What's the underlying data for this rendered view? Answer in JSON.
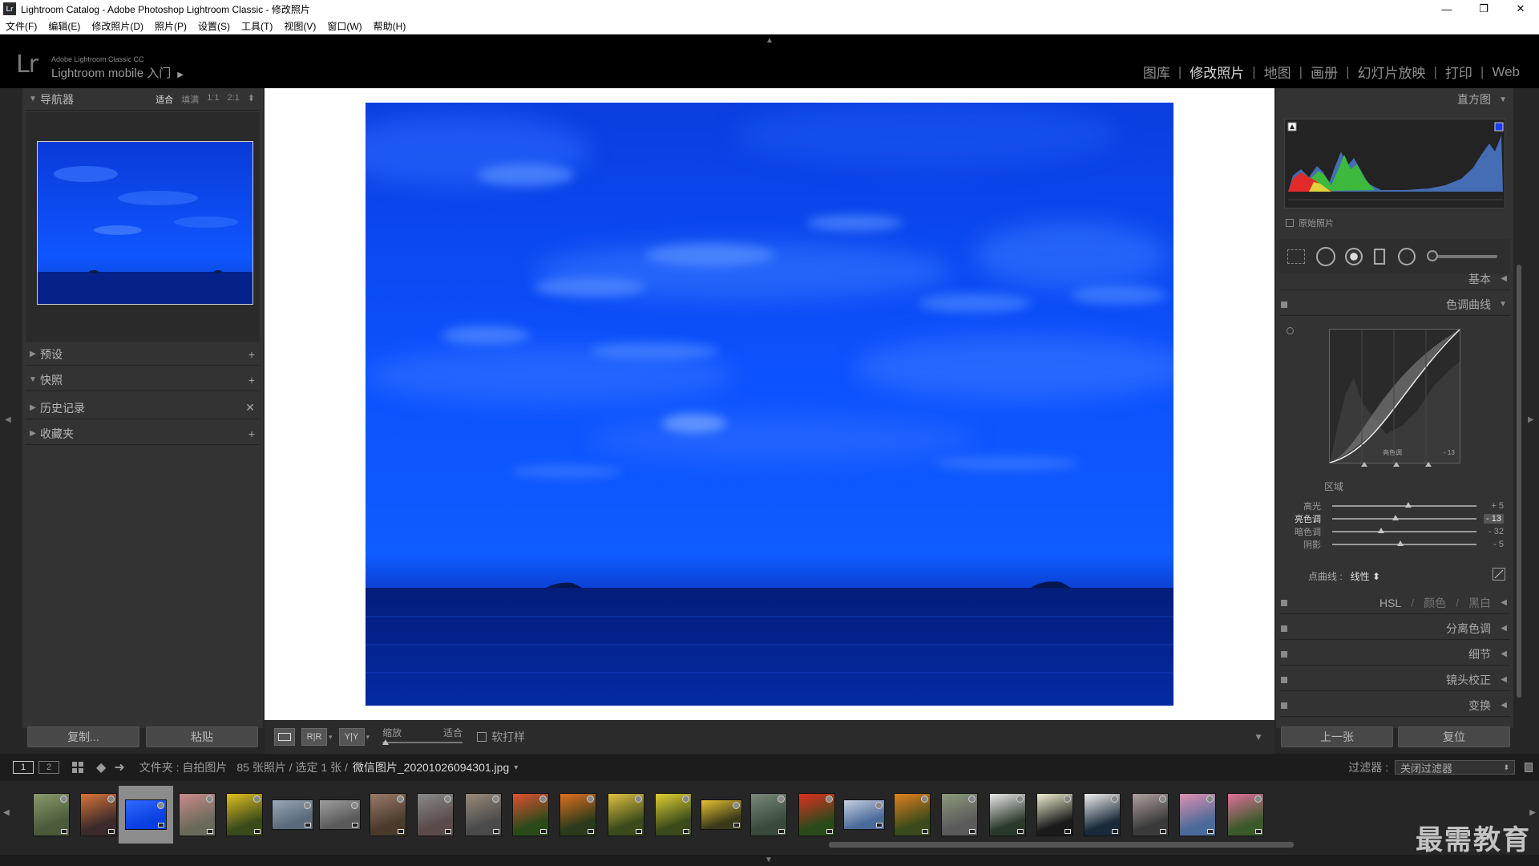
{
  "window": {
    "title": "Lightroom Catalog - Adobe Photoshop Lightroom Classic - 修改照片",
    "app_icon": "Lr",
    "minimize": "—",
    "maximize": "❐",
    "close": "✕"
  },
  "menu": [
    "文件(F)",
    "编辑(E)",
    "修改照片(D)",
    "照片(P)",
    "设置(S)",
    "工具(T)",
    "视图(V)",
    "窗口(W)",
    "帮助(H)"
  ],
  "identity": {
    "logo": "Lr",
    "product": "Adobe Lightroom Classic CC",
    "mobile": "Lightroom mobile 入门",
    "mobile_arrow": "▶"
  },
  "modules": [
    {
      "label": "图库",
      "active": false
    },
    {
      "label": "修改照片",
      "active": true
    },
    {
      "label": "地图",
      "active": false
    },
    {
      "label": "画册",
      "active": false
    },
    {
      "label": "幻灯片放映",
      "active": false
    },
    {
      "label": "打印",
      "active": false
    },
    {
      "label": "Web",
      "active": false
    }
  ],
  "left_panel": {
    "navigator": {
      "label": "导航器",
      "options": [
        "适合",
        "填满",
        "1:1",
        "2:1"
      ],
      "selected": "适合",
      "option_arrow": "⬍"
    },
    "presets": {
      "label": "预设",
      "action": "+"
    },
    "snapshots": {
      "label": "快照",
      "action": "+"
    },
    "history": {
      "label": "历史记录",
      "action": "✕"
    },
    "collections": {
      "label": "收藏夹",
      "action": "+"
    },
    "copy_button": "复制...",
    "paste_button": "粘贴"
  },
  "toolbar": {
    "view_ry": "R|R",
    "view_yy": "Y|Y",
    "zoom_label": "缩放",
    "zoom_value": "适合",
    "softproof": "软打样"
  },
  "filmbar": {
    "page1": "1",
    "page2": "2",
    "folder_label": "文件夹 : 自拍图片",
    "count": "85 张照片 / 选定 1 张 /",
    "filename": "微信图片_20201026094301.jpg",
    "filename_arrow": "▾",
    "filter_label": "过滤器 :",
    "filter_value": "关闭过滤器"
  },
  "right_panel": {
    "histogram_label": "直方图",
    "original_photo": "原始照片",
    "basic_label": "基本",
    "tone_curve_label": "色调曲线",
    "curve_hover_label": "亮色调",
    "curve_hover_value": "- 13",
    "region_label": "区域",
    "sliders": [
      {
        "label": "高光",
        "value": "+ 5",
        "pct": 0.53
      },
      {
        "label": "亮色调",
        "value": "- 13",
        "pct": 0.44
      },
      {
        "label": "暗色调",
        "value": "- 32",
        "pct": 0.34
      },
      {
        "label": "阴影",
        "value": "- 5",
        "pct": 0.47
      }
    ],
    "point_curve_label": "点曲线 :",
    "point_curve_value": "线性",
    "point_curve_arrow": "⬍",
    "hsl": "HSL",
    "hsl_sep": "/",
    "color": "颜色",
    "bw": "黑白",
    "split_toning": "分离色调",
    "detail": "细节",
    "lens_correction": "镜头校正",
    "transform": "变换",
    "prev_button": "上一张",
    "reset_button": "复位"
  },
  "watermark": "最需教育",
  "colors": {
    "accent_blue": "#0d4fe6",
    "panel_bg": "#333333",
    "frame_bg": "#ffffff"
  }
}
